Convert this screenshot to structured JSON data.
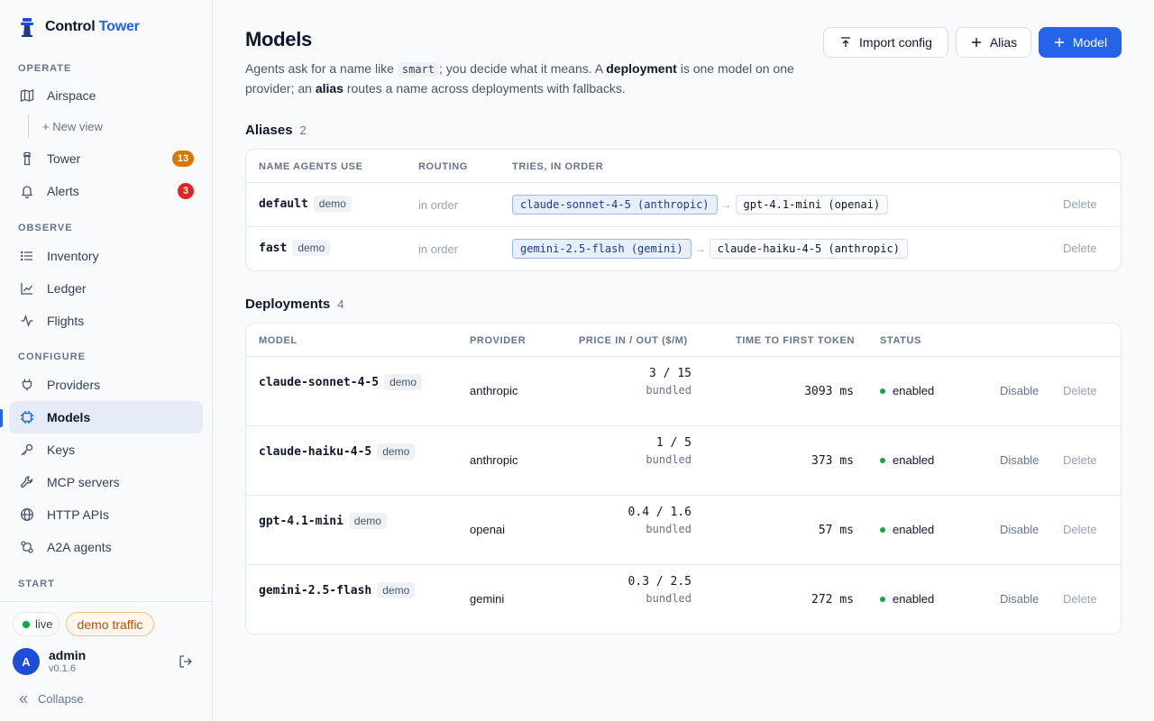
{
  "brand": {
    "name_part1": "Control",
    "name_part2": "Tower"
  },
  "sidebar": {
    "sections": {
      "operate": "OPERATE",
      "observe": "OBSERVE",
      "configure": "CONFIGURE",
      "start": "START"
    },
    "items": {
      "airspace": "Airspace",
      "new_view": "+ New view",
      "tower": "Tower",
      "tower_badge": "13",
      "alerts": "Alerts",
      "alerts_badge": "3",
      "inventory": "Inventory",
      "ledger": "Ledger",
      "flights": "Flights",
      "providers": "Providers",
      "models": "Models",
      "keys": "Keys",
      "mcp_servers": "MCP servers",
      "http_apis": "HTTP APIs",
      "a2a_agents": "A2A agents"
    },
    "footer": {
      "live": "live",
      "demo_traffic": "demo traffic",
      "avatar_letter": "A",
      "user_name": "admin",
      "version": "v0.1.6",
      "collapse": "Collapse"
    }
  },
  "header": {
    "title": "Models",
    "desc_1": "Agents ask for a name like ",
    "desc_code": "smart",
    "desc_2": "; you decide what it means. A ",
    "desc_bold1": "deployment",
    "desc_3": " is one model on one provider; an ",
    "desc_bold2": "alias",
    "desc_4": " routes a name across deployments with fallbacks.",
    "import_label": "Import config",
    "alias_label": "Alias",
    "model_label": "Model"
  },
  "aliases": {
    "title": "Aliases",
    "count": "2",
    "columns": {
      "name": "NAME AGENTS USE",
      "routing": "ROUTING",
      "tries": "TRIES, IN ORDER"
    },
    "rows": [
      {
        "name": "default",
        "tag": "demo",
        "routing": "in order",
        "tries": [
          "claude-sonnet-4-5 (anthropic)",
          "gpt-4.1-mini (openai)"
        ],
        "delete": "Delete"
      },
      {
        "name": "fast",
        "tag": "demo",
        "routing": "in order",
        "tries": [
          "gemini-2.5-flash (gemini)",
          "claude-haiku-4-5 (anthropic)"
        ],
        "delete": "Delete"
      }
    ]
  },
  "deployments": {
    "title": "Deployments",
    "count": "4",
    "columns": {
      "model": "MODEL",
      "provider": "PROVIDER",
      "price": "PRICE IN / OUT ($/M)",
      "ttft": "TIME TO FIRST TOKEN",
      "status": "STATUS"
    },
    "rows": [
      {
        "model": "claude-sonnet-4-5",
        "tag": "demo",
        "provider": "anthropic",
        "price": "3 / 15",
        "price_note": "bundled",
        "ttft": "3093 ms",
        "status": "enabled",
        "disable": "Disable",
        "delete": "Delete"
      },
      {
        "model": "claude-haiku-4-5",
        "tag": "demo",
        "provider": "anthropic",
        "price": "1 / 5",
        "price_note": "bundled",
        "ttft": "373 ms",
        "status": "enabled",
        "disable": "Disable",
        "delete": "Delete"
      },
      {
        "model": "gpt-4.1-mini",
        "tag": "demo",
        "provider": "openai",
        "price": "0.4 / 1.6",
        "price_note": "bundled",
        "ttft": "57 ms",
        "status": "enabled",
        "disable": "Disable",
        "delete": "Delete"
      },
      {
        "model": "gemini-2.5-flash",
        "tag": "demo",
        "provider": "gemini",
        "price": "0.3 / 2.5",
        "price_note": "bundled",
        "ttft": "272 ms",
        "status": "enabled",
        "disable": "Disable",
        "delete": "Delete"
      }
    ]
  },
  "colors": {
    "accent": "#2563eb",
    "enabled": "#16a34a",
    "badge_amber": "#d97706",
    "badge_red": "#dc2626"
  }
}
